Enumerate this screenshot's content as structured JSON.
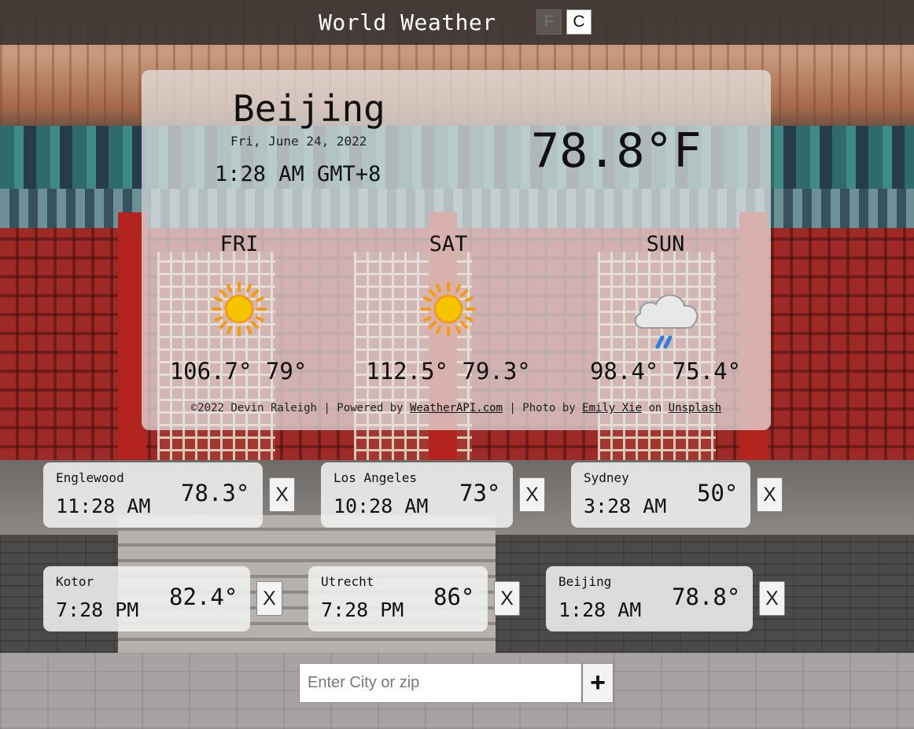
{
  "header": {
    "title": "World Weather",
    "unit_f_label": "F",
    "unit_c_label": "C",
    "active_unit": "F"
  },
  "current": {
    "city": "Beijing",
    "date": "Fri, June 24, 2022",
    "time": "1:28 AM GMT+8",
    "temperature": "78.8°F"
  },
  "forecast": [
    {
      "day": "FRI",
      "icon": "sunny-icon",
      "temps": "106.7° 79°"
    },
    {
      "day": "SAT",
      "icon": "sunny-icon",
      "temps": "112.5° 79.3°"
    },
    {
      "day": "SUN",
      "icon": "rain-cloud-icon",
      "temps": "98.4° 75.4°"
    }
  ],
  "footer": {
    "copyright": "©2022 Devin Raleigh",
    "sep1": " | ",
    "powered_prefix": "Powered by ",
    "powered_link": "WeatherAPI.com",
    "sep2": " | ",
    "photo_prefix": "Photo by ",
    "photographer_link": "Emily Xie",
    "on_text": " on ",
    "unsplash_link": "Unsplash"
  },
  "saved_cities": [
    {
      "name": "Englewood",
      "time": "11:28 AM",
      "temp": "78.3°",
      "remove_label": "X"
    },
    {
      "name": "Los Angeles",
      "time": "10:28 AM",
      "temp": "73°",
      "remove_label": "X"
    },
    {
      "name": "Sydney",
      "time": "3:28 AM",
      "temp": "50°",
      "remove_label": "X"
    },
    {
      "name": "Kotor",
      "time": "7:28 PM",
      "temp": "82.4°",
      "remove_label": "X"
    },
    {
      "name": "Utrecht",
      "time": "7:28 PM",
      "temp": "86°",
      "remove_label": "X"
    },
    {
      "name": "Beijing",
      "time": "1:28 AM",
      "temp": "78.8°",
      "remove_label": "X"
    }
  ],
  "search": {
    "placeholder": "Enter City or zip",
    "value": "",
    "add_label": "+"
  },
  "colors": {
    "sun": "#f7c400",
    "sun_rays": "#f39c12",
    "cloud": "#e6e6e6",
    "rain": "#2f7fe0"
  }
}
